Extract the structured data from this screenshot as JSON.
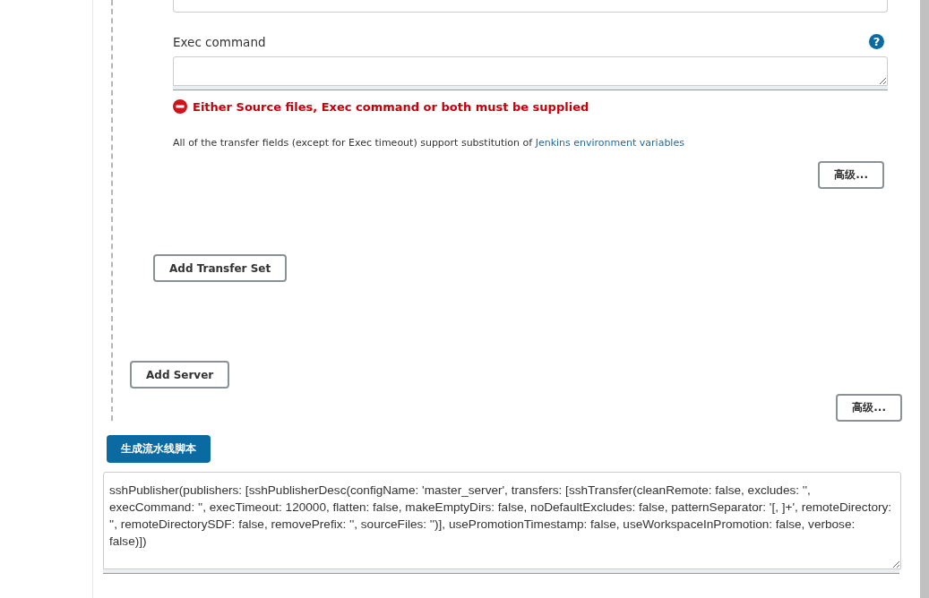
{
  "exec_command": {
    "label": "Exec command",
    "help": "?"
  },
  "error": "Either Source files, Exec command or both must be supplied",
  "note": {
    "text": "All of the transfer fields (except for Exec timeout) support substitution of ",
    "link": "Jenkins environment variables"
  },
  "transfer_advanced_button": "高级...",
  "add_transfer_set_button": "Add Transfer Set",
  "add_server_button": "Add Server",
  "server_advanced_button": "高级...",
  "generate_button": "生成流水线脚本",
  "script": "sshPublisher(publishers: [sshPublisherDesc(configName: 'master_server', transfers: [sshTransfer(cleanRemote: false, excludes: '', execCommand: '', execTimeout: 120000, flatten: false, makeEmptyDirs: false, noDefaultExcludes: false, patternSeparator: '[, ]+', remoteDirectory: '', remoteDirectorySDF: false, removePrefix: '', sourceFiles: '')], usePromotionTimestamp: false, useWorkspaceInPromotion: false, verbose: false)])"
}
